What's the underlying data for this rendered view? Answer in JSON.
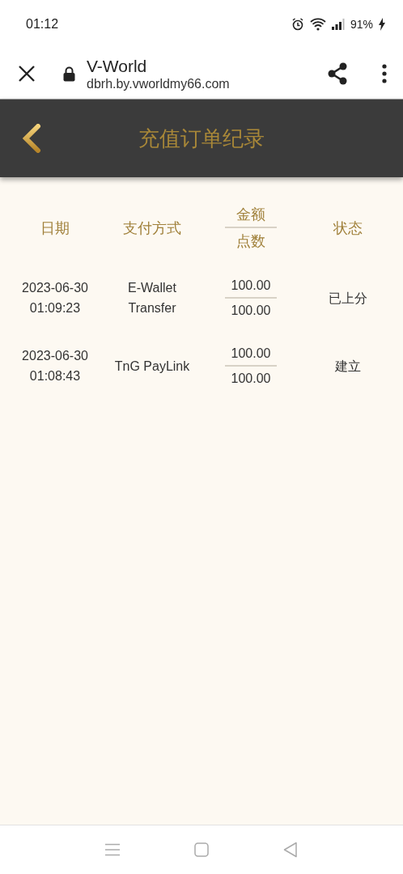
{
  "status_bar": {
    "time": "01:12",
    "battery": "91%"
  },
  "browser": {
    "title": "V-World",
    "url": "dbrh.by.vworldmy66.com"
  },
  "page_header": {
    "title": "充值订单纪录"
  },
  "table": {
    "columns": [
      {
        "kind": "single",
        "label": "日期"
      },
      {
        "kind": "single",
        "label": "支付方式"
      },
      {
        "kind": "stacked",
        "top": "金额",
        "bottom": "点数"
      },
      {
        "kind": "single",
        "label": "状态"
      }
    ],
    "rows": [
      {
        "date": "2023-06-30",
        "time": "01:09:23",
        "method": "E-Wallet Transfer",
        "amount": "100.00",
        "points": "100.00",
        "status": "已上分"
      },
      {
        "date": "2023-06-30",
        "time": "01:08:43",
        "method": "TnG PayLink",
        "amount": "100.00",
        "points": "100.00",
        "status": "建立"
      }
    ]
  }
}
